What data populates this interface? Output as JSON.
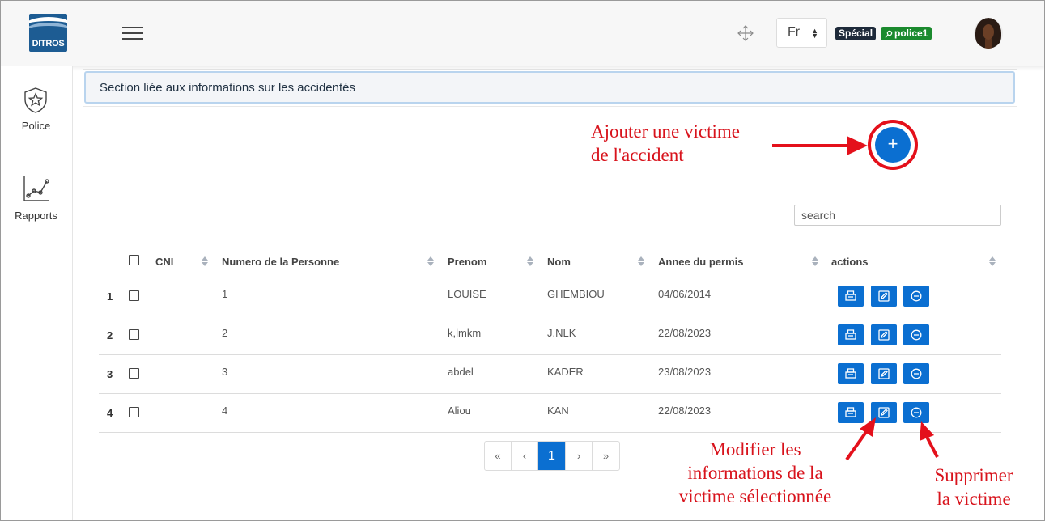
{
  "header": {
    "logo_text": "DITROS",
    "language": "Fr",
    "badge_special": "Spécial",
    "badge_user": "police1"
  },
  "sidebar": {
    "items": [
      {
        "label": "Police",
        "icon": "shield-star-icon"
      },
      {
        "label": "Rapports",
        "icon": "chart-line-icon"
      }
    ]
  },
  "section": {
    "title": "Section liée aux informations sur les accidentés"
  },
  "search": {
    "placeholder": "search"
  },
  "table": {
    "columns": [
      "CNI",
      "Numero de la Personne",
      "Prenom",
      "Nom",
      "Annee du permis",
      "actions"
    ],
    "rows": [
      {
        "index": "1",
        "cni": "",
        "numero": "1",
        "prenom": "LOUISE",
        "nom": "GHEMBIOU",
        "annee": "04/06/2014"
      },
      {
        "index": "2",
        "cni": "",
        "numero": "2",
        "prenom": "k,lmkm",
        "nom": "J.NLK",
        "annee": "22/08/2023"
      },
      {
        "index": "3",
        "cni": "",
        "numero": "3",
        "prenom": "abdel",
        "nom": "KADER",
        "annee": "23/08/2023"
      },
      {
        "index": "4",
        "cni": "",
        "numero": "4",
        "prenom": "Aliou",
        "nom": "KAN",
        "annee": "22/08/2023"
      }
    ],
    "action_icons": [
      "print-icon",
      "edit-icon",
      "minus-circle-icon"
    ]
  },
  "pagination": {
    "first": "«",
    "prev": "‹",
    "current": "1",
    "next": "›",
    "last": "»"
  },
  "annotations": {
    "add_line1": "Ajouter une victime",
    "add_line2": "de l'accident",
    "edit_line1": "Modifier les",
    "edit_line2": "informations de la",
    "edit_line3": "victime sélectionnée",
    "delete_line1": "Supprimer",
    "delete_line2": "la victime"
  },
  "colors": {
    "primary": "#0b6fd1",
    "annotation": "#d8131c",
    "badge_user": "#1b8a2e",
    "badge_special": "#1e2a3a"
  }
}
